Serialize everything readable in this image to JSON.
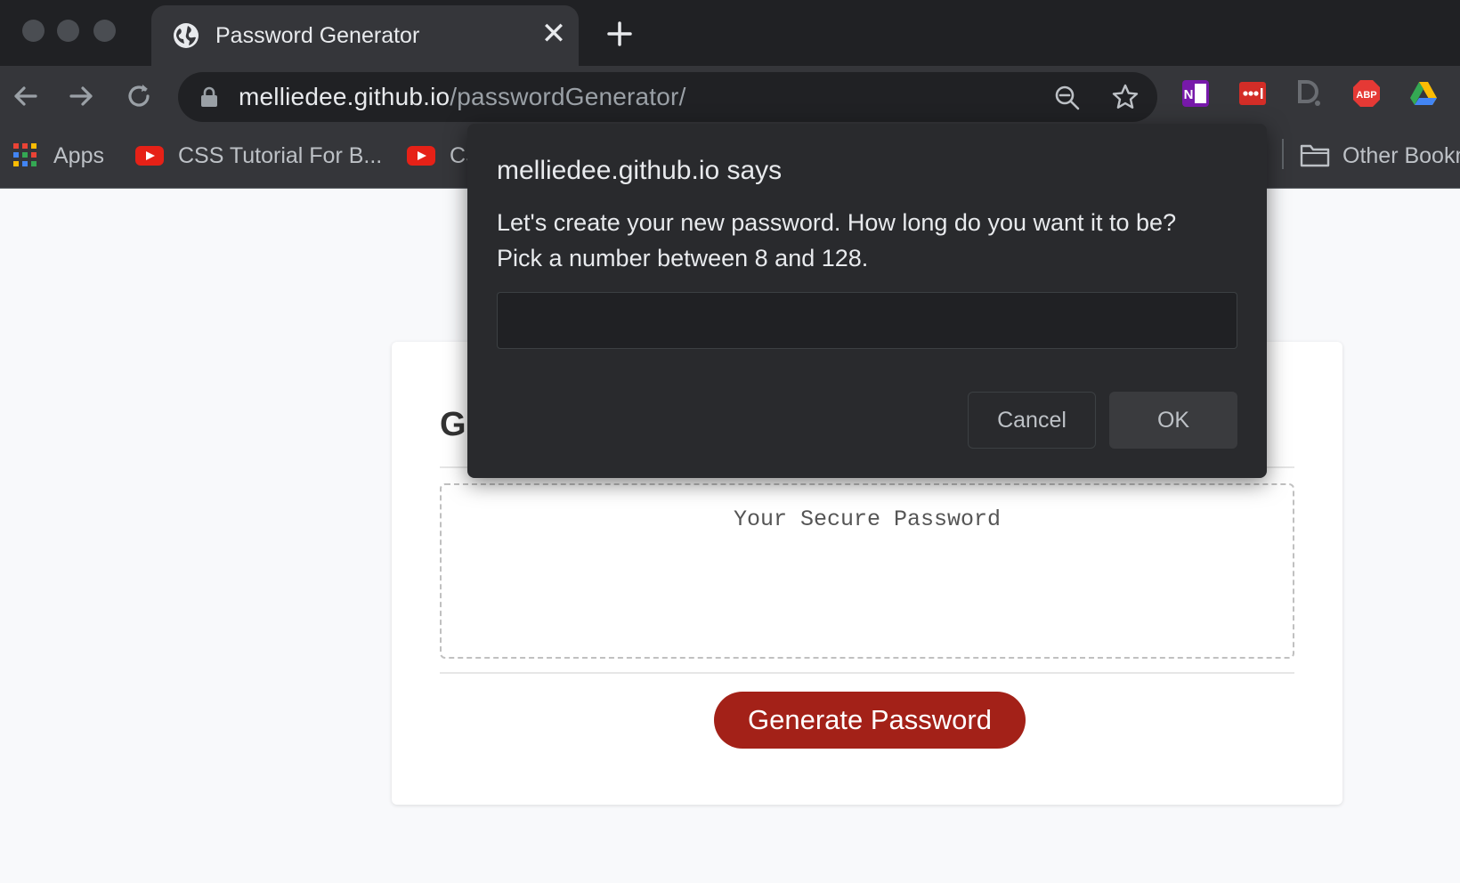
{
  "browser": {
    "tab": {
      "title": "Password Generator",
      "close_glyph": "✕",
      "icon": "globe-icon"
    },
    "new_tab_icon": "plus-icon",
    "omnibox": {
      "url_host": "melliedee.github.io",
      "url_path": "/passwordGenerator/"
    },
    "extensions": [
      "onenote-icon",
      "lastpass-icon",
      "dashlane-icon",
      "abp-icon",
      "google-drive-icon"
    ],
    "abp_label": "ABP",
    "bookmarks": {
      "apps_label": "Apps",
      "items": [
        "CSS Tutorial For B...",
        "CS"
      ],
      "other_label": "Other Bookm"
    }
  },
  "page": {
    "card_title": "G",
    "password_placeholder": "Your Secure Password",
    "generate_button": "Generate Password"
  },
  "dialog": {
    "title": "melliedee.github.io says",
    "message_line1": "Let's create your new password. How long do you want it to be?",
    "message_line2": "Pick a number between 8 and 128.",
    "input_value": "",
    "cancel_label": "Cancel",
    "ok_label": "OK"
  },
  "colors": {
    "accent": "#a32118",
    "dialog_bg": "#292a2d",
    "toolbar_bg": "#35363a",
    "titlebar_bg": "#202124"
  }
}
